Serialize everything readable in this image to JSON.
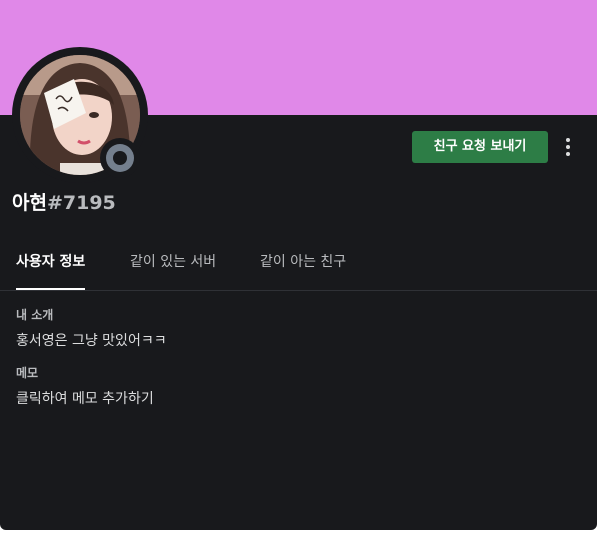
{
  "banner": {
    "color": "#e088e8"
  },
  "user": {
    "username": "아현",
    "discriminator": "#7195",
    "status": "offline",
    "status_icon": "offline-status-icon"
  },
  "actions": {
    "friend_request_label": "친구 요청 보내기",
    "more_icon": "vertical-ellipsis-icon"
  },
  "tabs": [
    {
      "label": "사용자 정보",
      "active": true
    },
    {
      "label": "같이 있는 서버",
      "active": false
    },
    {
      "label": "같이 아는 친구",
      "active": false
    }
  ],
  "about": {
    "title": "내 소개",
    "text": "홍서영은 그냥 맛있어ㅋㅋ"
  },
  "note": {
    "title": "메모",
    "placeholder": "클릭하여 메모 추가하기"
  },
  "colors": {
    "background": "#18191c",
    "button": "#2d7d46",
    "status_offline": "#747f8d"
  }
}
